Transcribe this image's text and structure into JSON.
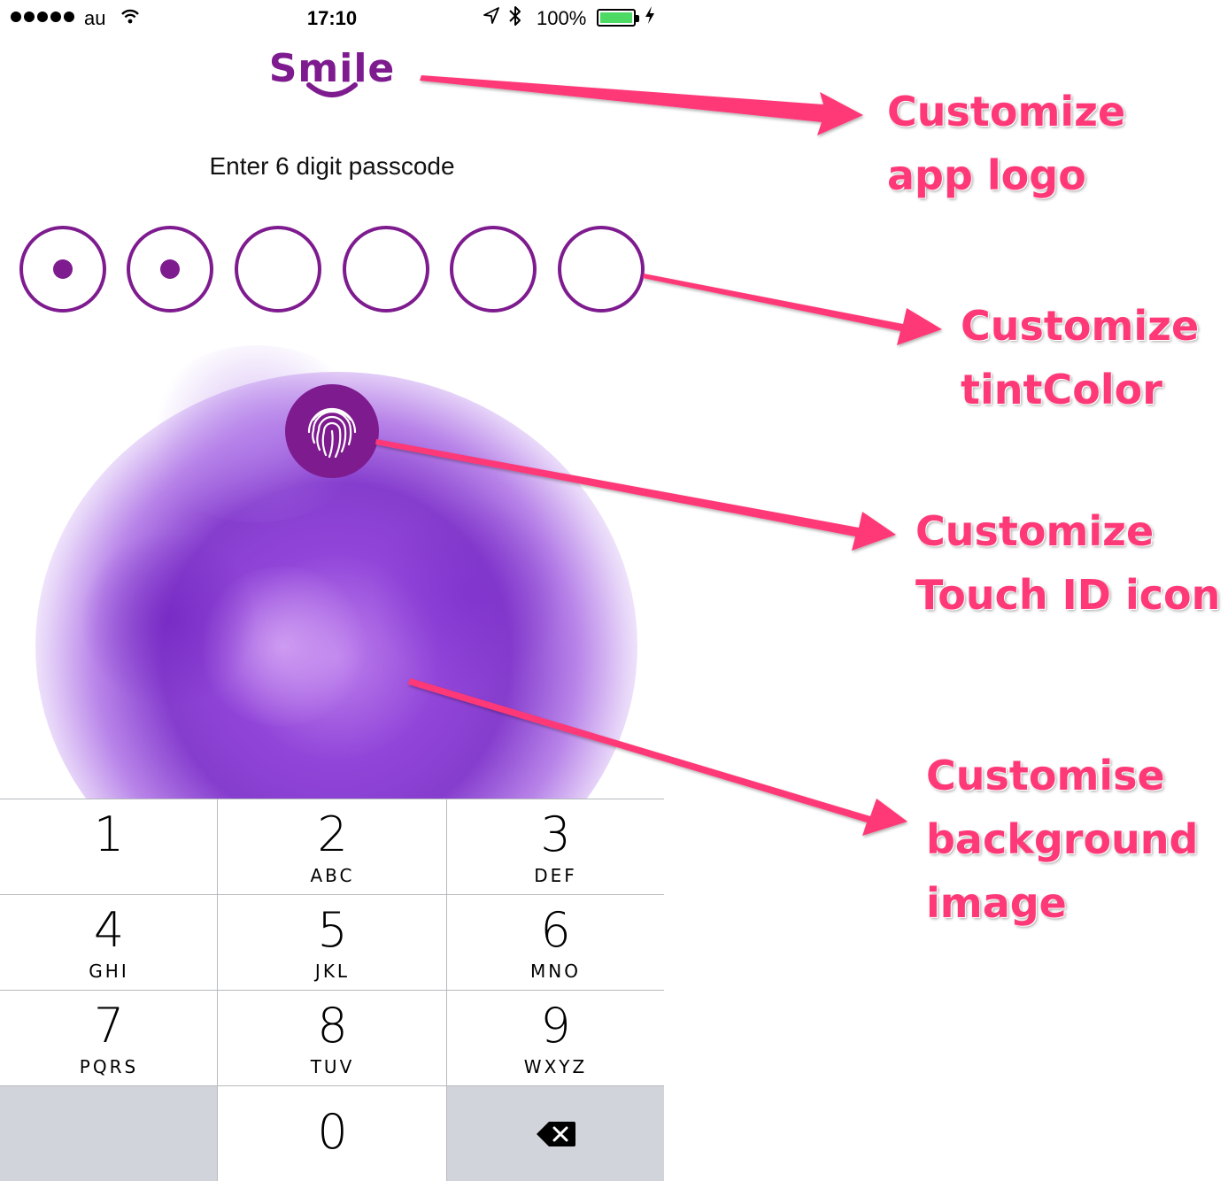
{
  "status_bar": {
    "carrier": "au",
    "time": "17:10",
    "battery_percent": "100%"
  },
  "app_logo": {
    "text": "Smile"
  },
  "prompt": "Enter 6 digit passcode",
  "passcode": {
    "length": 6,
    "entered": 2
  },
  "tint_color": "#7e1b8f",
  "keypad": {
    "keys": [
      {
        "number": "1",
        "letters": ""
      },
      {
        "number": "2",
        "letters": "ABC"
      },
      {
        "number": "3",
        "letters": "DEF"
      },
      {
        "number": "4",
        "letters": "GHI"
      },
      {
        "number": "5",
        "letters": "JKL"
      },
      {
        "number": "6",
        "letters": "MNO"
      },
      {
        "number": "7",
        "letters": "PQRS"
      },
      {
        "number": "8",
        "letters": "TUV"
      },
      {
        "number": "9",
        "letters": "WXYZ"
      },
      {
        "number": "0",
        "letters": ""
      }
    ]
  },
  "annotations": {
    "logo": {
      "line1": "Customize",
      "line2": "app logo"
    },
    "tint": {
      "line1": "Customize",
      "line2": "tintColor"
    },
    "touch_id": {
      "line1": "Customize",
      "line2": "Touch ID icon"
    },
    "background": {
      "line1": "Customise",
      "line2": "background",
      "line3": "image"
    }
  },
  "annotation_color": "#ff3877",
  "icons": [
    "wifi-icon",
    "location-icon",
    "bluetooth-icon",
    "battery-icon",
    "charging-icon",
    "fingerprint-icon",
    "delete-icon"
  ]
}
